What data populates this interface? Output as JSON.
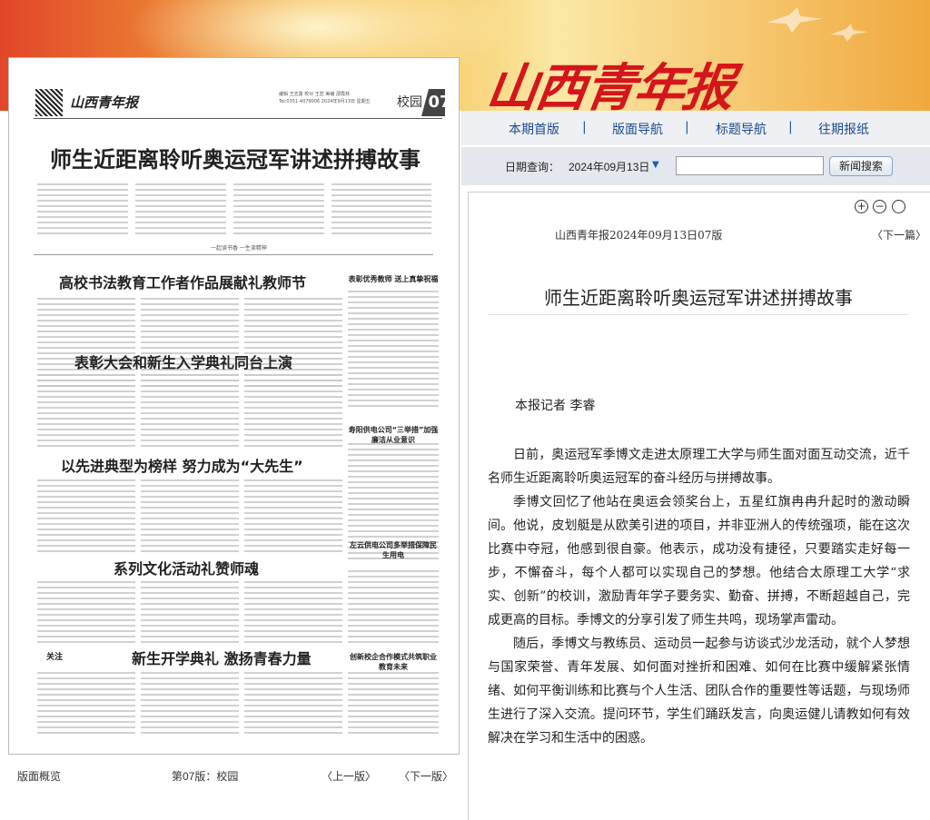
{
  "masthead": {
    "logo_text": "山西青年报"
  },
  "newspaper_page": {
    "mini_logo": "山西青年报",
    "editor_line": "编辑 王志勇 校对 王蕊 美编 邵霞林",
    "date_line": "Tel:0351-4079006 2024年9月13日 星期五",
    "section": "校园",
    "page_number": "07",
    "main_headline": "师生近距离聆听奥运冠军讲述拼搏故事",
    "subhead_calligraphy": "一起读书香 一生读精神",
    "headlines": [
      "高校书法教育工作者作品展献礼教师节",
      "表彰大会和新生入学典礼同台上演",
      "以先进典型为榜样 努力成为“大先生”",
      "系列文化活动礼赞师魂",
      "新生开学典礼 激扬青春力量"
    ],
    "sidebar_titles": [
      "表彰优秀教师 送上真挚祝福",
      "寿阳供电公司“三举措”加强廉洁从业意识",
      "左云供电公司多举措保障民生用电",
      "创新校企合作模式共筑职业教育未来"
    ],
    "focus_label": "关注"
  },
  "panel_footer": {
    "overview": "版面概览",
    "current_page": "第07版：校园",
    "prev": "〈上一版〉",
    "next": "〈下一版〉"
  },
  "nav": {
    "items": [
      "本期首版",
      "版面导航",
      "标题导航",
      "往期报纸"
    ],
    "separator": "|"
  },
  "search": {
    "date_label": "日期查询：",
    "date_value": "2024年09月13日",
    "button_label": "新闻搜索",
    "input_placeholder": ""
  },
  "article": {
    "tools": {
      "zoom_in": "+",
      "zoom_out": "−",
      "reset": "○"
    },
    "source": "山西青年报2024年09月13日07版",
    "next_link": "〈下一篇〉",
    "title": "师生近距离聆听奥运冠军讲述拼搏故事",
    "byline": "本报记者 李睿",
    "paragraphs": [
      "日前，奥运冠军季博文走进太原理工大学与师生面对面互动交流，近千名师生近距离聆听奥运冠军的奋斗经历与拼搏故事。",
      "季博文回忆了他站在奥运会领奖台上，五星红旗冉冉升起时的激动瞬间。他说，皮划艇是从欧美引进的项目，并非亚洲人的传统强项，能在这次比赛中夺冠，他感到很自豪。他表示，成功没有捷径，只要踏实走好每一步，不懈奋斗，每个人都可以实现自己的梦想。他结合太原理工大学“求实、创新”的校训，激励青年学子要务实、勤奋、拼搏，不断超越自己，完成更高的目标。季博文的分享引发了师生共鸣，现场掌声雷动。",
      "随后，季博文与教练员、运动员一起参与访谈式沙龙活动，就个人梦想与国家荣誉、青年发展、如何面对挫折和困难、如何在比赛中缓解紧张情绪、如何平衡训练和比赛与个人生活、团队合作的重要性等话题，与现场师生进行了深入交流。提问环节，学生们踊跃发言，向奥运健儿请教如何有效解决在学习和生活中的困惑。"
    ]
  }
}
